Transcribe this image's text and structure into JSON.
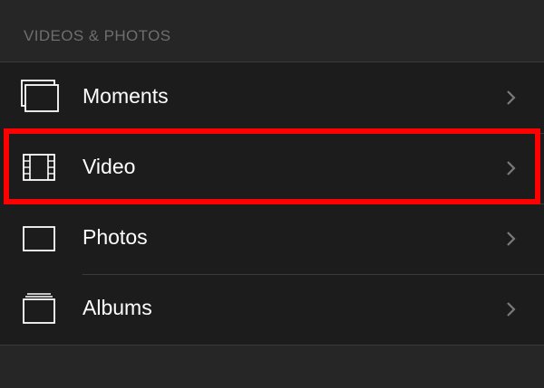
{
  "section": {
    "header": "VIDEOS & PHOTOS"
  },
  "items": [
    {
      "label": "Moments",
      "icon": "moments-icon"
    },
    {
      "label": "Video",
      "icon": "film-icon"
    },
    {
      "label": "Photos",
      "icon": "photo-icon"
    },
    {
      "label": "Albums",
      "icon": "albums-icon"
    }
  ],
  "colors": {
    "background": "#262626",
    "list_background": "#1c1c1c",
    "text": "#ffffff",
    "header_text": "#6e6e6e",
    "separator": "#3a3a3a",
    "highlight": "#ff0000"
  }
}
